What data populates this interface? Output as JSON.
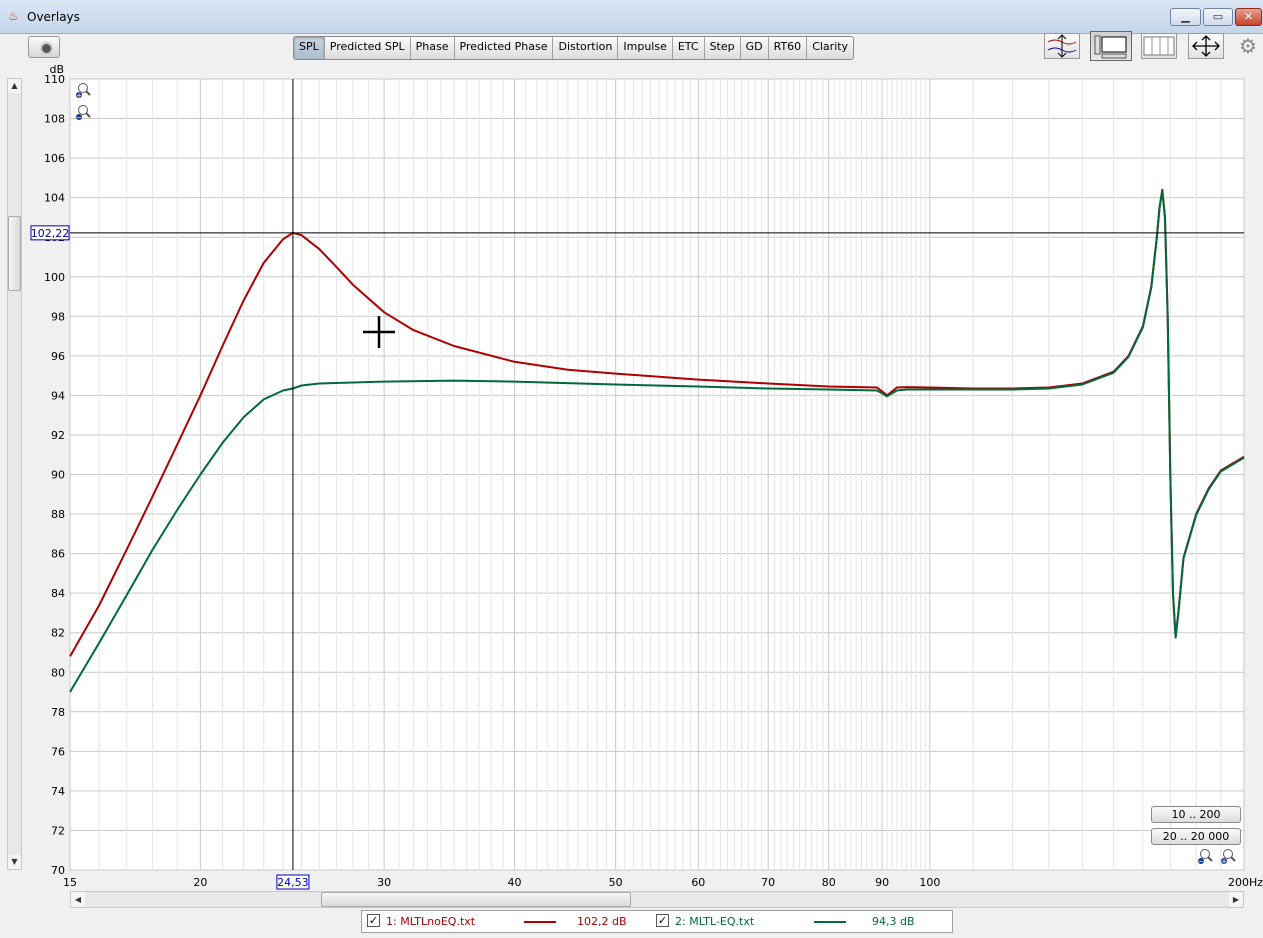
{
  "window": {
    "title": "Overlays",
    "minimize": "▁",
    "maximize": "▭",
    "close": "✕"
  },
  "tabs": [
    "SPL",
    "Predicted SPL",
    "Phase",
    "Predicted Phase",
    "Distortion",
    "Impulse",
    "ETC",
    "Step",
    "GD",
    "RT60",
    "Clarity"
  ],
  "active_tab": "SPL",
  "colors": {
    "series1": "#b00000",
    "series2": "#006a3c",
    "grid": "#c9c9c9",
    "cursor": "#000000",
    "label_box": "#0000c0"
  },
  "cursor": {
    "x": 24.53,
    "y": 102.22,
    "x_label": "24,53",
    "y_label": "102,22"
  },
  "range_buttons": [
    "10 .. 200",
    "20 .. 20 000"
  ],
  "legend": [
    {
      "checked": "✓",
      "label": "1: MLTLnoEQ.txt",
      "value": "102,2 dB"
    },
    {
      "checked": "✓",
      "label": "2: MLTL-EQ.txt",
      "value": "94,3 dB"
    }
  ],
  "chart_data": {
    "type": "line",
    "xscale": "log",
    "xlim": [
      15,
      200
    ],
    "ylim": [
      70,
      110
    ],
    "ylabel": "dB",
    "xunit": "Hz",
    "yticks": [
      70,
      72,
      74,
      76,
      78,
      80,
      82,
      84,
      86,
      88,
      90,
      92,
      94,
      96,
      98,
      100,
      102,
      104,
      106,
      108,
      110
    ],
    "xticks": [
      15,
      20,
      30,
      40,
      50,
      60,
      70,
      80,
      90,
      100,
      200
    ],
    "xtick_labels": [
      "15",
      "20",
      "30",
      "40",
      "50",
      "60",
      "70",
      "80",
      "90",
      "100",
      "200Hz"
    ],
    "grid": true,
    "series": [
      {
        "name": "1: MLTLnoEQ.txt",
        "x": [
          15,
          16,
          17,
          18,
          19,
          20,
          21,
          22,
          23,
          24,
          24.53,
          25,
          26,
          27,
          28,
          30,
          32,
          35,
          40,
          45,
          50,
          60,
          70,
          80,
          89,
          90,
          91,
          92,
          93,
          95,
          100,
          110,
          120,
          130,
          140,
          150,
          155,
          160,
          163,
          165,
          166,
          167,
          168,
          169,
          170,
          171,
          172,
          173,
          175,
          180,
          185,
          190,
          200
        ],
        "y": [
          80.8,
          83.4,
          86.2,
          88.9,
          91.5,
          94.0,
          96.5,
          98.8,
          100.7,
          101.9,
          102.22,
          102.1,
          101.4,
          100.5,
          99.6,
          98.2,
          97.3,
          96.5,
          95.7,
          95.3,
          95.1,
          94.8,
          94.6,
          94.45,
          94.4,
          94.2,
          94.0,
          94.2,
          94.4,
          94.42,
          94.4,
          94.35,
          94.35,
          94.4,
          94.6,
          95.2,
          96.0,
          97.5,
          99.5,
          102.0,
          103.5,
          104.4,
          103.0,
          98.0,
          90.0,
          84.0,
          81.8,
          83.0,
          85.8,
          88.0,
          89.3,
          90.2,
          90.9
        ]
      },
      {
        "name": "2: MLTL-EQ.txt",
        "x": [
          15,
          16,
          17,
          18,
          19,
          20,
          21,
          22,
          23,
          24,
          24.53,
          25,
          26,
          28,
          30,
          35,
          40,
          50,
          60,
          70,
          80,
          89,
          90,
          91,
          92,
          93,
          95,
          100,
          110,
          120,
          130,
          140,
          150,
          155,
          160,
          163,
          165,
          166,
          167,
          168,
          169,
          170,
          171,
          172,
          173,
          175,
          180,
          185,
          190,
          200
        ],
        "y": [
          79.0,
          81.5,
          83.9,
          86.2,
          88.2,
          90.0,
          91.6,
          92.9,
          93.8,
          94.25,
          94.35,
          94.5,
          94.6,
          94.65,
          94.7,
          94.75,
          94.7,
          94.55,
          94.45,
          94.35,
          94.3,
          94.25,
          94.1,
          93.95,
          94.1,
          94.25,
          94.3,
          94.3,
          94.3,
          94.3,
          94.35,
          94.55,
          95.15,
          95.95,
          97.45,
          99.45,
          101.95,
          103.45,
          104.35,
          102.95,
          97.95,
          89.95,
          83.95,
          81.75,
          82.95,
          85.75,
          87.95,
          89.25,
          90.15,
          90.85
        ]
      }
    ]
  }
}
